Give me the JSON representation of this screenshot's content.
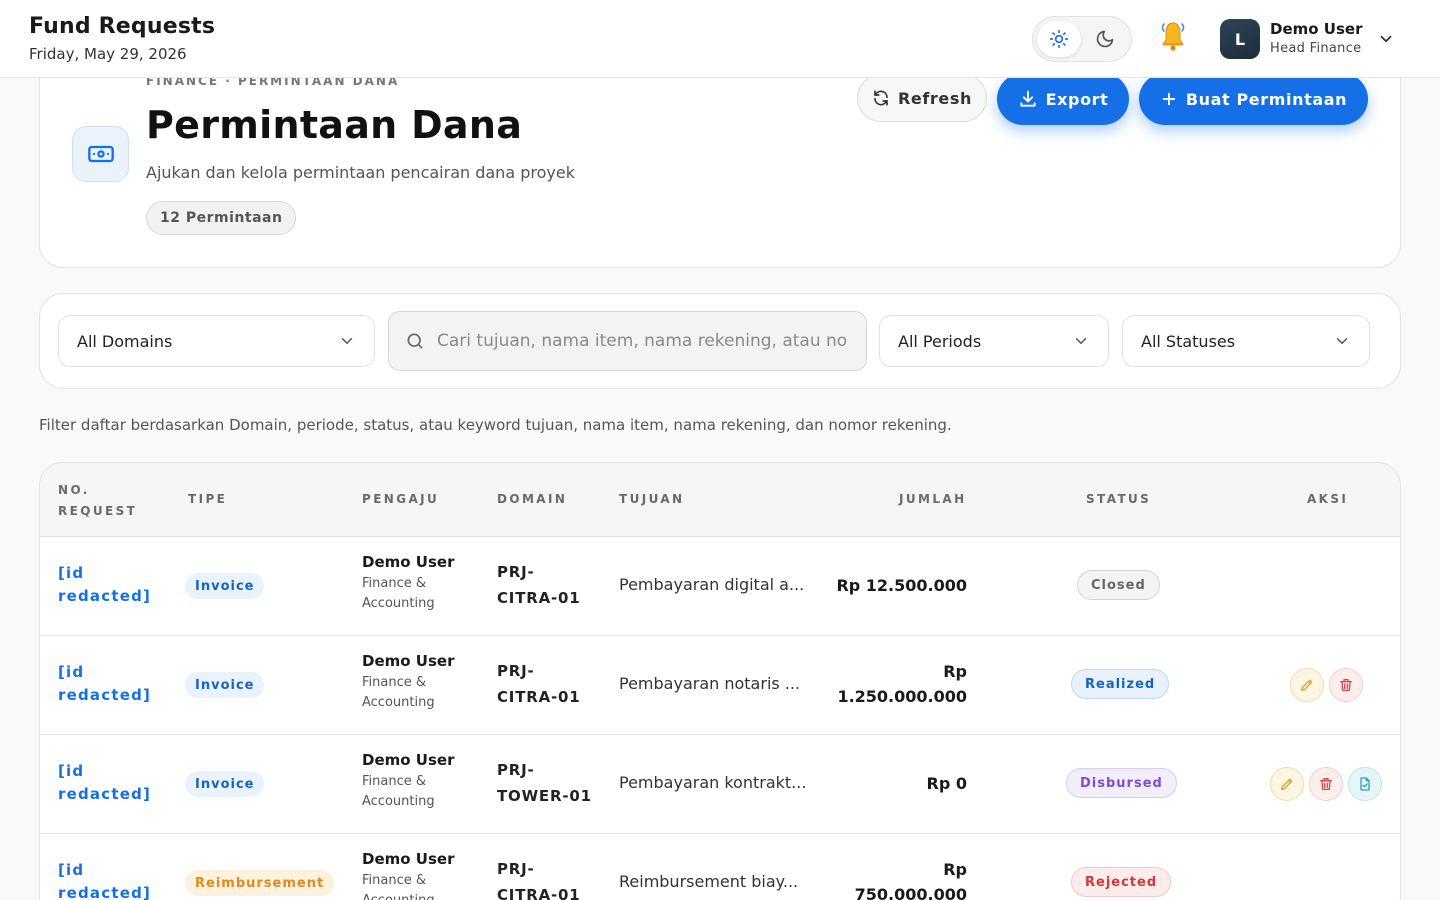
{
  "topbar": {
    "title": "Fund Requests",
    "date": "Friday, May 29, 2026",
    "user_initial": "L",
    "user_name": "Demo User",
    "user_role": "Head Finance"
  },
  "header": {
    "breadcrumb": "FINANCE · PERMINTAAN DANA",
    "title": "Permintaan Dana",
    "subtitle": "Ajukan dan kelola permintaan pencairan dana proyek",
    "count_badge": "12 Permintaan",
    "refresh_label": "Refresh",
    "export_label": "Export",
    "create_label": "Buat Permintaan"
  },
  "filters": {
    "domain_value": "All Domains",
    "search_placeholder": "Cari tujuan, nama item, nama rekening, atau no",
    "period_value": "All Periods",
    "status_value": "All Statuses",
    "hint": "Filter daftar berdasarkan Domain, periode, status, atau keyword tujuan, nama item, nama rekening, dan nomor rekening."
  },
  "table": {
    "headers": {
      "no_request_1": "NO.",
      "no_request_2": "REQUEST",
      "tipe": "TIPE",
      "pengaju": "PENGAJU",
      "domain": "DOMAIN",
      "tujuan": "TUJUAN",
      "jumlah": "JUMLAH",
      "status": "STATUS",
      "aksi": "AKSI"
    },
    "rows": [
      {
        "id_1": "[id",
        "id_2": "redacted]",
        "tipe": "Invoice",
        "pengaju_name": "Demo User",
        "pengaju_dept_1": "Finance &",
        "pengaju_dept_2": "Accounting",
        "domain_1": "PRJ-",
        "domain_2": "CITRA-01",
        "tujuan": "Pembayaran digital a...",
        "jumlah_1": "Rp 12.500.000",
        "jumlah_2": "",
        "status": "Closed"
      },
      {
        "id_1": "[id",
        "id_2": "redacted]",
        "tipe": "Invoice",
        "pengaju_name": "Demo User",
        "pengaju_dept_1": "Finance &",
        "pengaju_dept_2": "Accounting",
        "domain_1": "PRJ-",
        "domain_2": "CITRA-01",
        "tujuan": "Pembayaran notaris ...",
        "jumlah_1": "Rp",
        "jumlah_2": "1.250.000.000",
        "status": "Realized"
      },
      {
        "id_1": "[id",
        "id_2": "redacted]",
        "tipe": "Invoice",
        "pengaju_name": "Demo User",
        "pengaju_dept_1": "Finance &",
        "pengaju_dept_2": "Accounting",
        "domain_1": "PRJ-",
        "domain_2": "TOWER-01",
        "tujuan": "Pembayaran kontrakt...",
        "jumlah_1": "Rp 0",
        "jumlah_2": "",
        "status": "Disbursed"
      },
      {
        "id_1": "[id",
        "id_2": "redacted]",
        "tipe": "Reimbursement",
        "pengaju_name": "Demo User",
        "pengaju_dept_1": "Finance &",
        "pengaju_dept_2": "Accounting",
        "domain_1": "PRJ-",
        "domain_2": "CITRA-01",
        "tujuan": "Reimbursement biay...",
        "jumlah_1": "Rp",
        "jumlah_2": "750.000.000",
        "status": "Rejected"
      }
    ]
  },
  "icons": {
    "theme_light": "sun-icon",
    "theme_dark": "moon-icon",
    "notifications": "bell-icon",
    "user_menu": "chevron-down-icon",
    "page": "banknote-icon",
    "refresh": "refresh-icon",
    "export": "download-icon",
    "create": "plus-icon",
    "search": "search-icon",
    "edit": "pencil-icon",
    "delete": "trash-icon",
    "document": "document-icon"
  },
  "colors": {
    "accent": "#1570e8",
    "edit": "#e0a020",
    "delete": "#e04848",
    "document": "#2ba5b8"
  }
}
